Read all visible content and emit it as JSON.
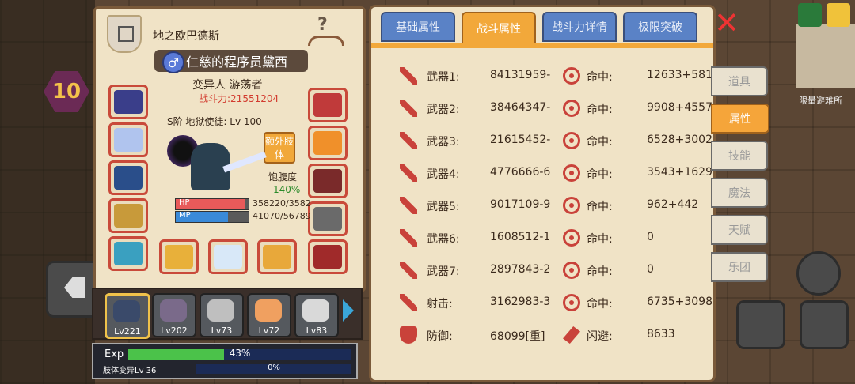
{
  "character": {
    "class_name": "地之欧巴德斯",
    "name": "仁慈的程序员黛西",
    "gender_symbol": "♂",
    "tags": "变异人 游荡者",
    "power": "战斗力:21551204",
    "rank": "S阶 地狱使徒: Lv 100",
    "extra_limb_label": "额外肢体",
    "satiety_label": "饱腹度",
    "satiety_value": "140%",
    "hp_label": "HP",
    "hp_value": "358220/3582",
    "hp_fill": 0.95,
    "mp_label": "MP",
    "mp_value": "41070/56789",
    "mp_fill": 0.72
  },
  "party": [
    {
      "level": "Lv221",
      "color": "#3a4a6a",
      "selected": true
    },
    {
      "level": "Lv202",
      "color": "#7a6a8a",
      "selected": false
    },
    {
      "level": "Lv73",
      "color": "#bfbfbf",
      "selected": false
    },
    {
      "level": "Lv72",
      "color": "#f0a060",
      "selected": false
    },
    {
      "level": "Lv83",
      "color": "#d9d9d9",
      "selected": false
    }
  ],
  "exp": {
    "label": "Exp",
    "percent_text": "43%",
    "fill": 0.43,
    "mutation_label": "肢体变异Lv 36",
    "mutation_percent": "0%"
  },
  "tabs": [
    "基础属性",
    "战斗属性",
    "战斗力详情",
    "极限突破"
  ],
  "active_tab": 1,
  "stats": [
    {
      "label": "武器1:",
      "value": "84131959-",
      "label2": "命中:",
      "value2": "12633+581",
      "icon": "sword",
      "icon2": "target"
    },
    {
      "label": "武器2:",
      "value": "38464347-",
      "label2": "命中:",
      "value2": "9908+4557",
      "icon": "sword",
      "icon2": "target"
    },
    {
      "label": "武器3:",
      "value": "21615452-",
      "label2": "命中:",
      "value2": "6528+3002",
      "icon": "sword",
      "icon2": "target"
    },
    {
      "label": "武器4:",
      "value": "4776666-6",
      "label2": "命中:",
      "value2": "3543+1629",
      "icon": "sword",
      "icon2": "target"
    },
    {
      "label": "武器5:",
      "value": "9017109-9",
      "label2": "命中:",
      "value2": "962+442",
      "icon": "sword",
      "icon2": "target"
    },
    {
      "label": "武器6:",
      "value": "1608512-1",
      "label2": "命中:",
      "value2": "0",
      "icon": "sword",
      "icon2": "target"
    },
    {
      "label": "武器7:",
      "value": "2897843-2",
      "label2": "命中:",
      "value2": "0",
      "icon": "sword",
      "icon2": "target"
    },
    {
      "label": "射击:",
      "value": "3162983-3",
      "label2": "命中:",
      "value2": "6735+3098",
      "icon": "sword",
      "icon2": "target"
    },
    {
      "label": "防御:",
      "value": "68099[重]",
      "label2": "闪避:",
      "value2": "8633",
      "icon": "shield",
      "icon2": "dodge"
    }
  ],
  "side_tabs": [
    "道具",
    "属性",
    "技能",
    "魔法",
    "天赋",
    "乐团"
  ],
  "active_side_tab": 1,
  "close_symbol": "✕",
  "minimap_label": "限量避难所",
  "player_level_badge": "10"
}
